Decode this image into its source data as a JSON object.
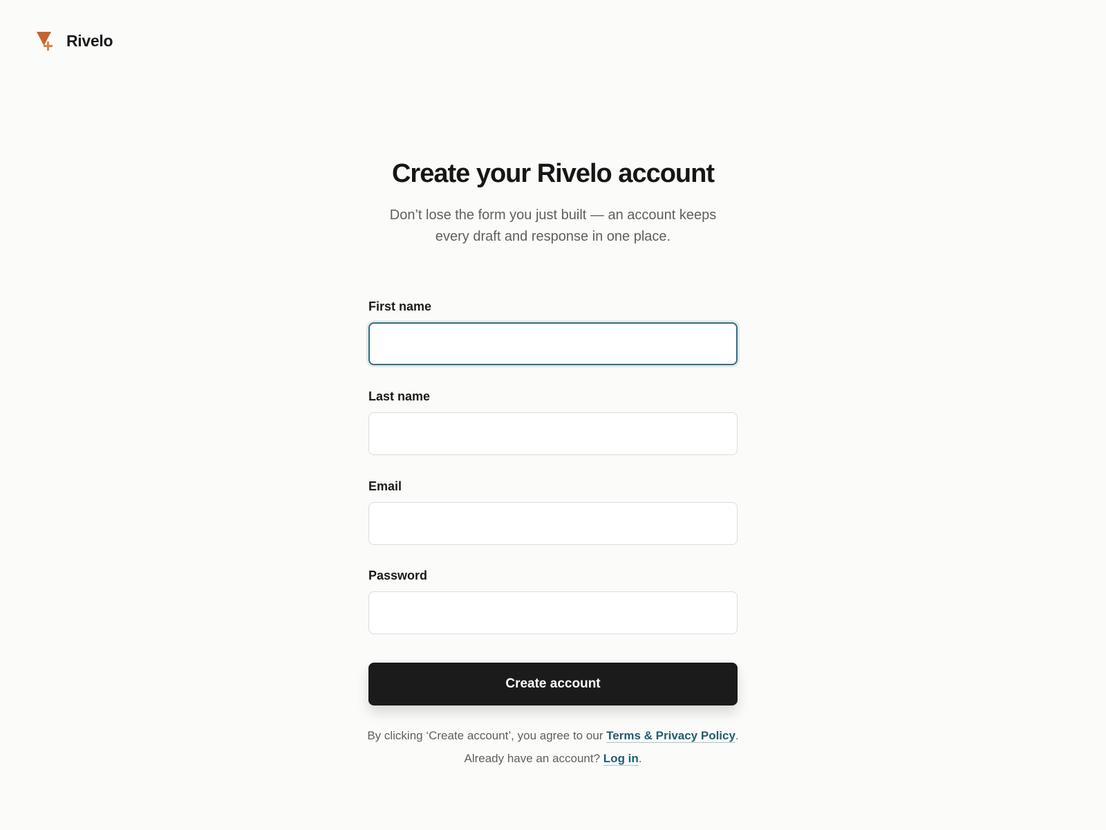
{
  "brand": {
    "name": "Rivelo",
    "mark_icon": "triangle-plus-logo-icon",
    "mark_color": "#c8622f"
  },
  "heading": {
    "title": "Create your Rivelo account",
    "subtitle": "Don’t lose the form you just built — an account keeps every draft and response in one place."
  },
  "form": {
    "fields": [
      {
        "label": "First name",
        "value": "",
        "placeholder": "",
        "focused": true
      },
      {
        "label": "Last name",
        "value": "",
        "placeholder": "",
        "focused": false
      },
      {
        "label": "Email",
        "value": "",
        "placeholder": "",
        "focused": false
      },
      {
        "label": "Password",
        "value": "",
        "placeholder": "",
        "focused": false
      }
    ],
    "submit_label": "Create account"
  },
  "legal": {
    "prefix": "By clicking ‘Create account’, you agree to our ",
    "link_label": "Terms & Privacy Policy",
    "suffix": "."
  },
  "login": {
    "prefix": "Already have an account? ",
    "link_label": "Log in",
    "suffix": "."
  },
  "colors": {
    "accent": "#1f5f6f",
    "focus_border": "#2f6f80",
    "button_bg": "#1b1b1b",
    "page_bg": "#fbfbfa"
  }
}
